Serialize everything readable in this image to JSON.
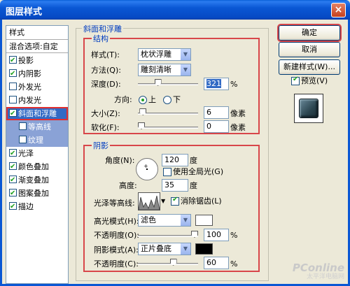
{
  "window": {
    "title": "图层样式",
    "close": "×"
  },
  "style_list": {
    "header": "样式",
    "items": [
      {
        "label": "混合选项:自定",
        "checkbox": false
      },
      {
        "label": "投影",
        "checked": true
      },
      {
        "label": "内阴影",
        "checked": true
      },
      {
        "label": "外发光",
        "checked": false
      },
      {
        "label": "内发光",
        "checked": false
      },
      {
        "label": "斜面和浮雕",
        "checked": true,
        "selected": true
      },
      {
        "label": "等高线",
        "checked": false,
        "sub": true
      },
      {
        "label": "纹理",
        "checked": false,
        "sub": true
      },
      {
        "label": "光泽",
        "checked": true
      },
      {
        "label": "颜色叠加",
        "checked": true
      },
      {
        "label": "渐变叠加",
        "checked": true
      },
      {
        "label": "图案叠加",
        "checked": true
      },
      {
        "label": "描边",
        "checked": true
      }
    ]
  },
  "bevel": {
    "group_title": "斜面和浮雕",
    "structure": {
      "title": "结构",
      "style_label": "样式(T):",
      "style_value": "枕状浮雕",
      "method_label": "方法(Q):",
      "method_value": "雕刻清晰",
      "depth_label": "深度(D):",
      "depth_value": "321",
      "depth_unit": "%",
      "depth_fraction": 0.31,
      "direction_label": "方向:",
      "dir_up": "上",
      "dir_down": "下",
      "size_label": "大小(Z):",
      "size_value": "6",
      "size_unit": "像素",
      "size_fraction": 0.03,
      "soften_label": "软化(F):",
      "soften_value": "0",
      "soften_unit": "像素",
      "soften_fraction": 0.0
    },
    "shading": {
      "title": "阴影",
      "angle_label": "角度(N):",
      "angle_value": "120",
      "angle_unit": "度",
      "global_light_label": "使用全局光(G)",
      "altitude_label": "高度:",
      "altitude_value": "35",
      "altitude_unit": "度",
      "gloss_label": "光泽等高线:",
      "antialias_label": "消除锯齿(L)",
      "highlight_label": "高光模式(H):",
      "highlight_value": "滤色",
      "highlight_color": "#ffffff",
      "h_opacity_label": "不透明度(O):",
      "h_opacity_value": "100",
      "h_opacity_unit": "%",
      "h_opacity_fraction": 1.0,
      "shadow_label": "阴影模式(A):",
      "shadow_value": "正片叠底",
      "shadow_color": "#000000",
      "s_opacity_label": "不透明度(C):",
      "s_opacity_value": "60",
      "s_opacity_unit": "%",
      "s_opacity_fraction": 0.6
    }
  },
  "buttons": {
    "ok": "确定",
    "cancel": "取消",
    "new_style": "新建样式(W)...",
    "preview": "预览(V)"
  },
  "watermark": {
    "brand": "PConline",
    "sub": "太平洋电脑网"
  },
  "colors": {
    "accent_red": "#d8464a",
    "title_blue": "#0a57d4",
    "legend_blue": "#003dc0"
  }
}
